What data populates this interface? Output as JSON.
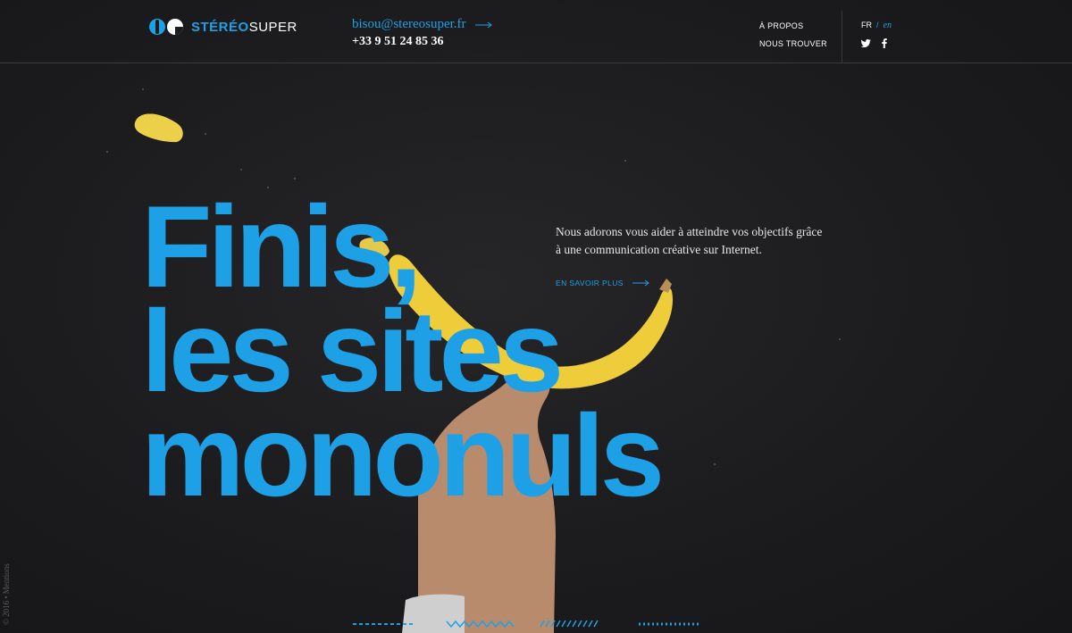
{
  "header": {
    "logo": {
      "text_blue": "STÉRÉO",
      "text_white": "SUPER"
    },
    "contact": {
      "email": "bisou@stereosuper.fr",
      "phone": "+33 9 51 24 85 36"
    },
    "nav": [
      {
        "label": "À PROPOS"
      },
      {
        "label": "NOUS TROUVER"
      }
    ],
    "lang": {
      "fr": "FR",
      "separator": "/",
      "en": "en"
    },
    "social": [
      {
        "icon": "twitter-icon"
      },
      {
        "icon": "facebook-icon"
      }
    ]
  },
  "hero": {
    "title_lines": [
      "Finis,",
      "les sites",
      "mononuls"
    ],
    "intro": "Nous adorons vous aider à atteindre vos objectifs grâce à une communication créative sur Internet.",
    "cta_label": "EN SAVOIR PLUS"
  },
  "footer": {
    "side_note": "© 2016 • Mentions"
  },
  "colors": {
    "accent": "#1ea0e6",
    "background": "#1c1c1e",
    "banana": "#f2d03b",
    "skin": "#c99a7a"
  }
}
